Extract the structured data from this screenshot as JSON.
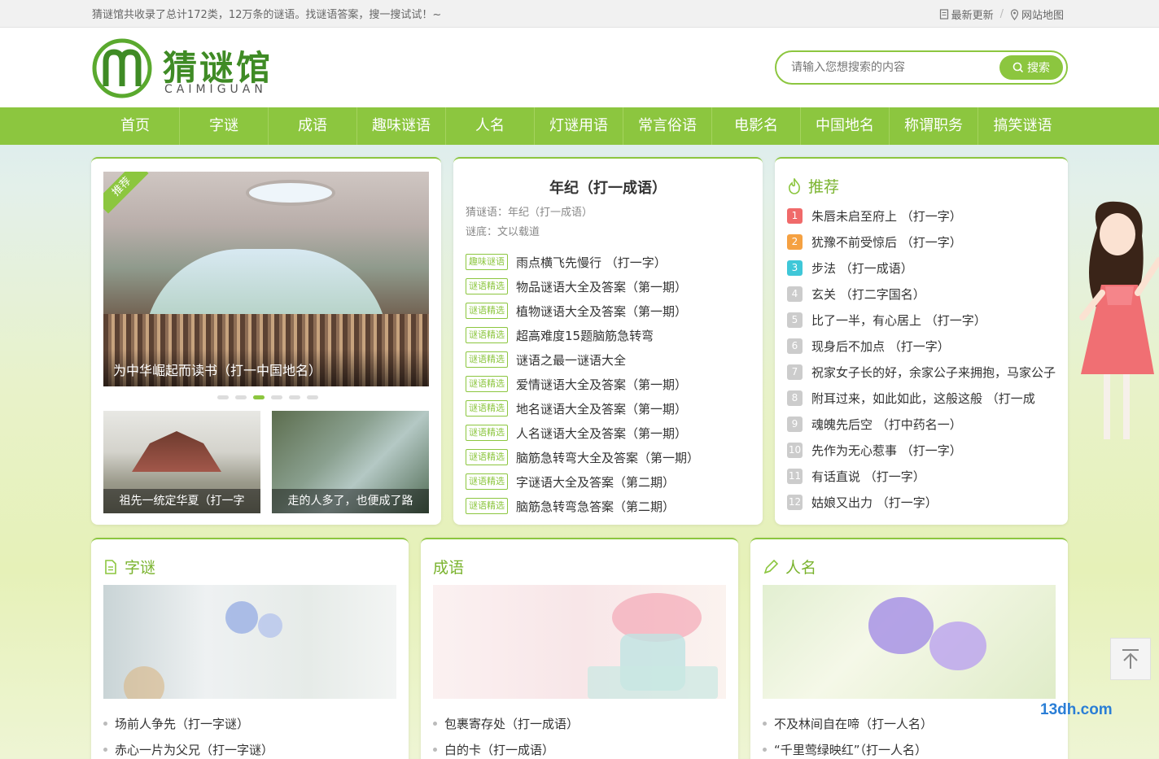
{
  "topbar": {
    "tip": "猜谜馆共收录了总计172类，12万条的谜语。找谜语答案，搜一搜试试！~",
    "latest": "最新更新",
    "sitemap": "网站地图",
    "sep": "/"
  },
  "logo": {
    "cn": "猜谜馆",
    "en": "CAIMIGUAN"
  },
  "search": {
    "placeholder": "请输入您想搜索的内容",
    "button": "搜索"
  },
  "nav": [
    "首页",
    "字谜",
    "成语",
    "趣味谜语",
    "人名",
    "灯谜用语",
    "常言俗语",
    "电影名",
    "中国地名",
    "称谓职务",
    "搞笑谜语"
  ],
  "slider": {
    "ribbon": "推荐",
    "caption": "为中华崛起而读书（打一中国地名）",
    "thumb1": "祖先一统定华夏（打一字",
    "thumb2": "走的人多了，也便成了路"
  },
  "featured": {
    "title": "年纪（打一成语）",
    "riddle": "猜谜语：年纪（打一成语）",
    "answer": "谜底：文以载道"
  },
  "list": [
    {
      "tag": "趣味谜语",
      "text": "雨点横飞先慢行 （打一字）"
    },
    {
      "tag": "谜语精选",
      "text": "物品谜语大全及答案（第一期）"
    },
    {
      "tag": "谜语精选",
      "text": "植物谜语大全及答案（第一期）"
    },
    {
      "tag": "谜语精选",
      "text": "超高难度15题脑筋急转弯"
    },
    {
      "tag": "谜语精选",
      "text": "谜语之最一谜语大全"
    },
    {
      "tag": "谜语精选",
      "text": "爱情谜语大全及答案（第一期）"
    },
    {
      "tag": "谜语精选",
      "text": "地名谜语大全及答案（第一期）"
    },
    {
      "tag": "谜语精选",
      "text": "人名谜语大全及答案（第一期）"
    },
    {
      "tag": "谜语精选",
      "text": "脑筋急转弯大全及答案（第一期）"
    },
    {
      "tag": "谜语精选",
      "text": "字谜语大全及答案（第二期）"
    },
    {
      "tag": "谜语精选",
      "text": "脑筋急转弯急答案（第二期）"
    }
  ],
  "recommend": {
    "title": "推荐",
    "items": [
      {
        "n": "1",
        "text": "朱唇未启至府上 （打一字）"
      },
      {
        "n": "2",
        "text": "犹豫不前受惊后 （打一字）"
      },
      {
        "n": "3",
        "text": "步法 （打一成语）"
      },
      {
        "n": "4",
        "text": "玄关 （打二字国名）"
      },
      {
        "n": "5",
        "text": "比了一半，有心居上 （打一字）"
      },
      {
        "n": "6",
        "text": "现身后不加点 （打一字）"
      },
      {
        "n": "7",
        "text": "祝家女子长的好，余家公子来拥抱，马家公子"
      },
      {
        "n": "8",
        "text": "附耳过来，如此如此，这般这般 （打一成"
      },
      {
        "n": "9",
        "text": "魂魄先后空 （打中药名一）"
      },
      {
        "n": "10",
        "text": "先作为无心惹事 （打一字）"
      },
      {
        "n": "11",
        "text": "有话直说 （打一字）"
      },
      {
        "n": "12",
        "text": "姑娘又出力 （打一字）"
      }
    ]
  },
  "blocks": [
    {
      "title": "字谜",
      "items": [
        "场前人争先（打一字谜）",
        "赤心一片为父兄（打一字谜）"
      ]
    },
    {
      "title": "成语",
      "items": [
        "包裹寄存处（打一成语）",
        "白的卡（打一成语）"
      ]
    },
    {
      "title": "人名",
      "items": [
        "不及林间自在啼（打一人名）",
        "“千里莺绿映红”（打一人名）"
      ]
    }
  ],
  "watermark": "13dh.com",
  "colors": {
    "accent": "#8cc63f",
    "rank1": "#f06a6a",
    "rank2": "#f5a142",
    "rank3": "#3fc7d8"
  }
}
